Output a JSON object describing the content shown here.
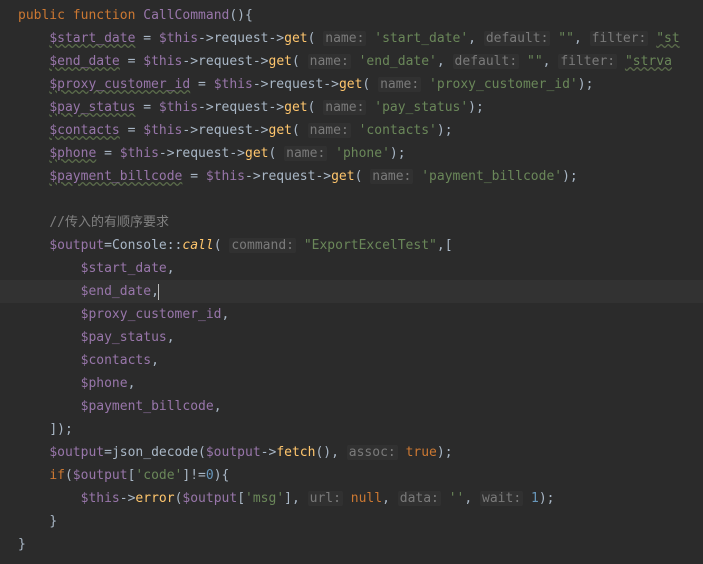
{
  "tokens": {
    "public": "public",
    "function": "function",
    "fnName": "CallCommand",
    "this": "$this",
    "request": "request",
    "get": "get",
    "name": "name:",
    "default": "default:",
    "filter": "filter:",
    "command": "command:",
    "assoc": "assoc:",
    "url": "url:",
    "data": "data:",
    "wait": "wait:",
    "Console": "Console",
    "call": "call",
    "json_decode": "json_decode",
    "fetch": "fetch",
    "error": "error",
    "if": "if",
    "null": "null",
    "true": "true"
  },
  "vars": {
    "start_date": "$start_date",
    "end_date": "$end_date",
    "proxy_customer_id": "$proxy_customer_id",
    "pay_status": "$pay_status",
    "contacts": "$contacts",
    "phone": "$phone",
    "payment_billcode": "$payment_billcode",
    "output": "$output"
  },
  "strings": {
    "start_date": "'start_date'",
    "end_date": "'end_date'",
    "proxy_customer_id": "'proxy_customer_id'",
    "pay_status": "'pay_status'",
    "contacts": "'contacts'",
    "phone": "'phone'",
    "payment_billcode": "'payment_billcode'",
    "empty": "\"\"",
    "strva": "\"strva",
    "st": "\"st",
    "ExportExcelTest": "\"ExportExcelTest\"",
    "code": "'code'",
    "msg": "'msg'",
    "emptySingle": "''"
  },
  "comment": "//传入的有顺序要求",
  "nums": {
    "zero": "0",
    "one": "1"
  }
}
